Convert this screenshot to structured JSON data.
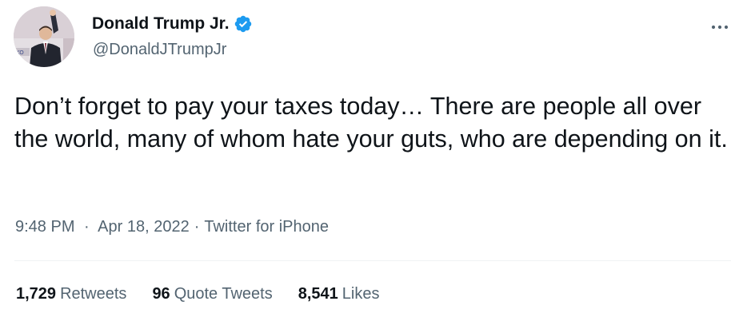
{
  "author": {
    "display_name": "Donald Trump Jr.",
    "handle": "@DonaldJTrumpJr",
    "verified": true,
    "avatar_icon": "profile-photo"
  },
  "tweet": {
    "text": "Don’t forget to pay your taxes today… There are people all over the world, many of whom hate your guts, who are depending on it.",
    "time": "9:48 PM",
    "date": "Apr 18, 2022",
    "source": "Twitter for iPhone",
    "separator": "·"
  },
  "stats": {
    "retweets_count": "1,729",
    "retweets_label": "Retweets",
    "quote_count": "96",
    "quote_label": "Quote Tweets",
    "likes_count": "8,541",
    "likes_label": "Likes"
  },
  "colors": {
    "text_primary": "#0f1419",
    "text_secondary": "#536471",
    "verified_blue": "#1d9bf0",
    "divider": "#eff3f4"
  },
  "icons": {
    "verified": "verified-badge-icon",
    "more": "more-horizontal-icon"
  }
}
